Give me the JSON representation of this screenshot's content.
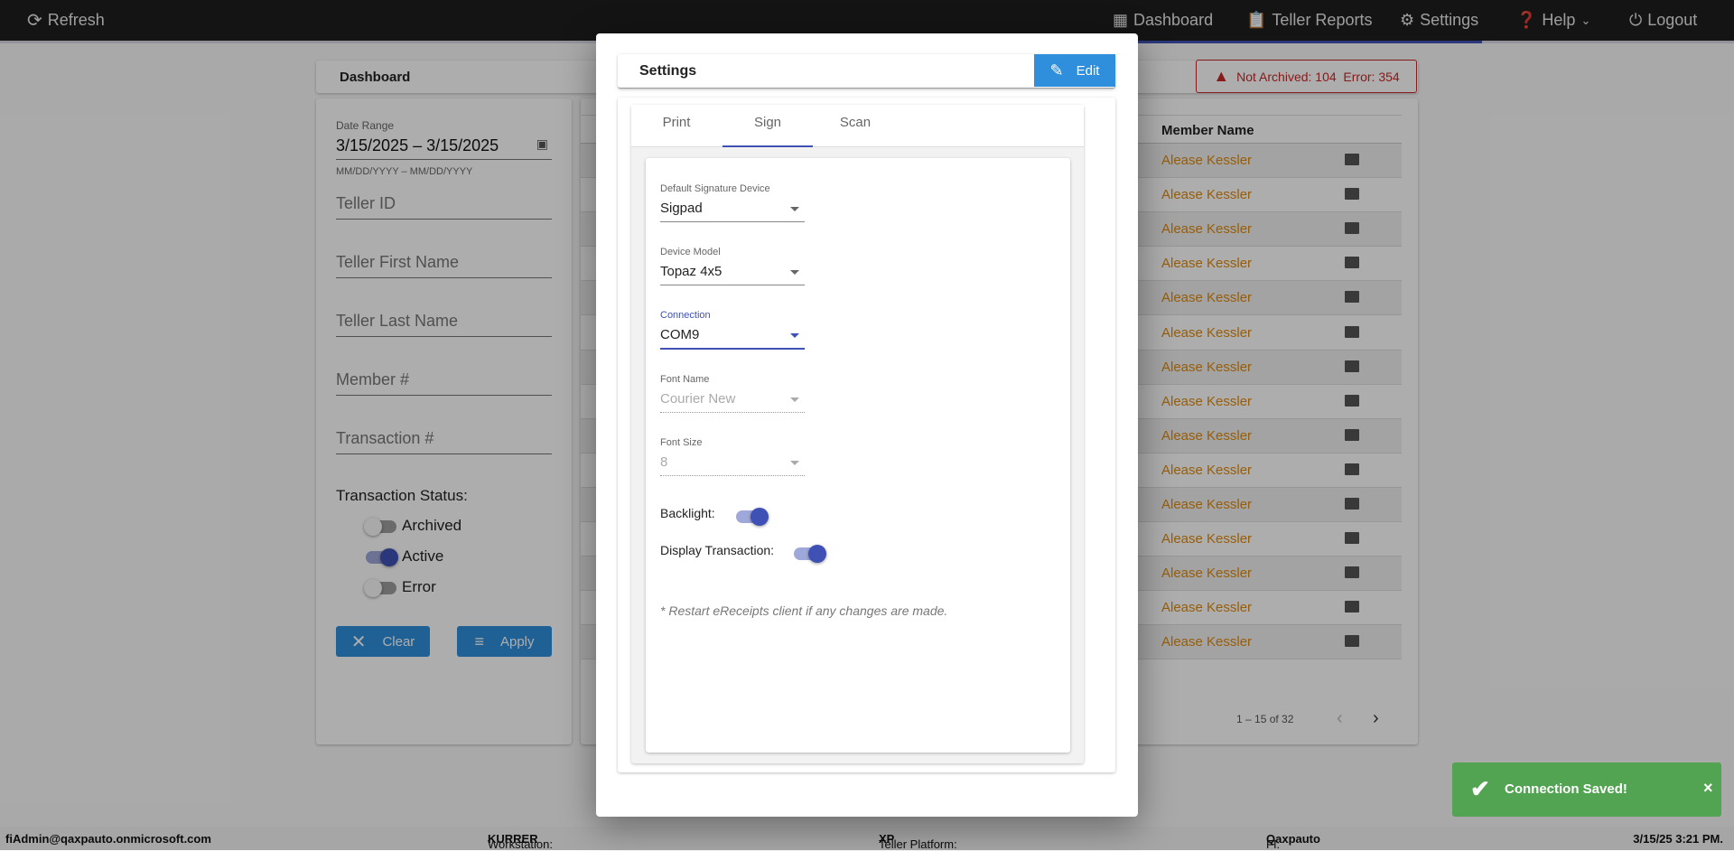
{
  "topbar": {
    "refresh": "Refresh",
    "nav": [
      {
        "label": "Dashboard",
        "icon": "dashboard-icon"
      },
      {
        "label": "Teller Reports",
        "icon": "clipboard-icon"
      },
      {
        "label": "Settings",
        "icon": "gear-icon"
      },
      {
        "label": "Help",
        "icon": "help-icon"
      },
      {
        "label": "Logout",
        "icon": "power-icon"
      }
    ]
  },
  "dashboard": {
    "title": "Dashboard",
    "alert": "Not Archived: 104  Error: 354"
  },
  "filters": {
    "date_label": "Date Range",
    "date_value": "3/15/2025 – 3/15/2025",
    "date_hint": "MM/DD/YYYY – MM/DD/YYYY",
    "teller_id": "Teller ID",
    "first_name": "Teller First Name",
    "last_name": "Teller Last Name",
    "member": "Member #",
    "transaction": "Transaction #",
    "status_label": "Transaction Status:",
    "statuses": [
      {
        "label": "Archived",
        "on": false
      },
      {
        "label": "Active",
        "on": true
      },
      {
        "label": "Error",
        "on": false
      }
    ],
    "clear": "Clear",
    "apply": "Apply"
  },
  "table": {
    "column": "Member Name",
    "rows": [
      "Alease Kessler",
      "Alease Kessler",
      "Alease Kessler",
      "Alease Kessler",
      "Alease Kessler",
      "Alease Kessler",
      "Alease Kessler",
      "Alease Kessler",
      "Alease Kessler",
      "Alease Kessler",
      "Alease Kessler",
      "Alease Kessler",
      "Alease Kessler",
      "Alease Kessler",
      "Alease Kessler"
    ],
    "pagination": "1 – 15 of 32"
  },
  "modal": {
    "title": "Settings",
    "edit": "Edit",
    "tabs": [
      "Print",
      "Sign",
      "Scan"
    ],
    "active_tab": "Sign",
    "fields": [
      {
        "label": "Default Signature Device",
        "value": "Sigpad"
      },
      {
        "label": "Device Model",
        "value": "Topaz 4x5"
      },
      {
        "label": "Connection",
        "value": "COM9"
      },
      {
        "label": "Font Name",
        "value": "Courier New"
      },
      {
        "label": "Font Size",
        "value": "8"
      }
    ],
    "backlight": "Backlight:",
    "backlight_on": true,
    "display_transaction": "Display Transaction:",
    "display_transaction_on": true,
    "note": "* Restart eReceipts client if any changes are made."
  },
  "toast": {
    "message": "Connection Saved!",
    "close": "×"
  },
  "footer": {
    "user": "fiAdmin@qaxpauto.onmicrosoft.com",
    "workstation_label": "Workstation: ",
    "workstation": "KURRER",
    "platform_label": "Teller Platform: ",
    "platform": "XP",
    "fi_label": "FI: ",
    "fi": "Qaxpauto",
    "datetime": "3/15/25 3:21 PM."
  },
  "colors": {
    "accent": "#3f51b5",
    "edit": "#2f8fdc",
    "toast": "#52a452",
    "link": "#e08a0c",
    "alert": "#c62828"
  }
}
